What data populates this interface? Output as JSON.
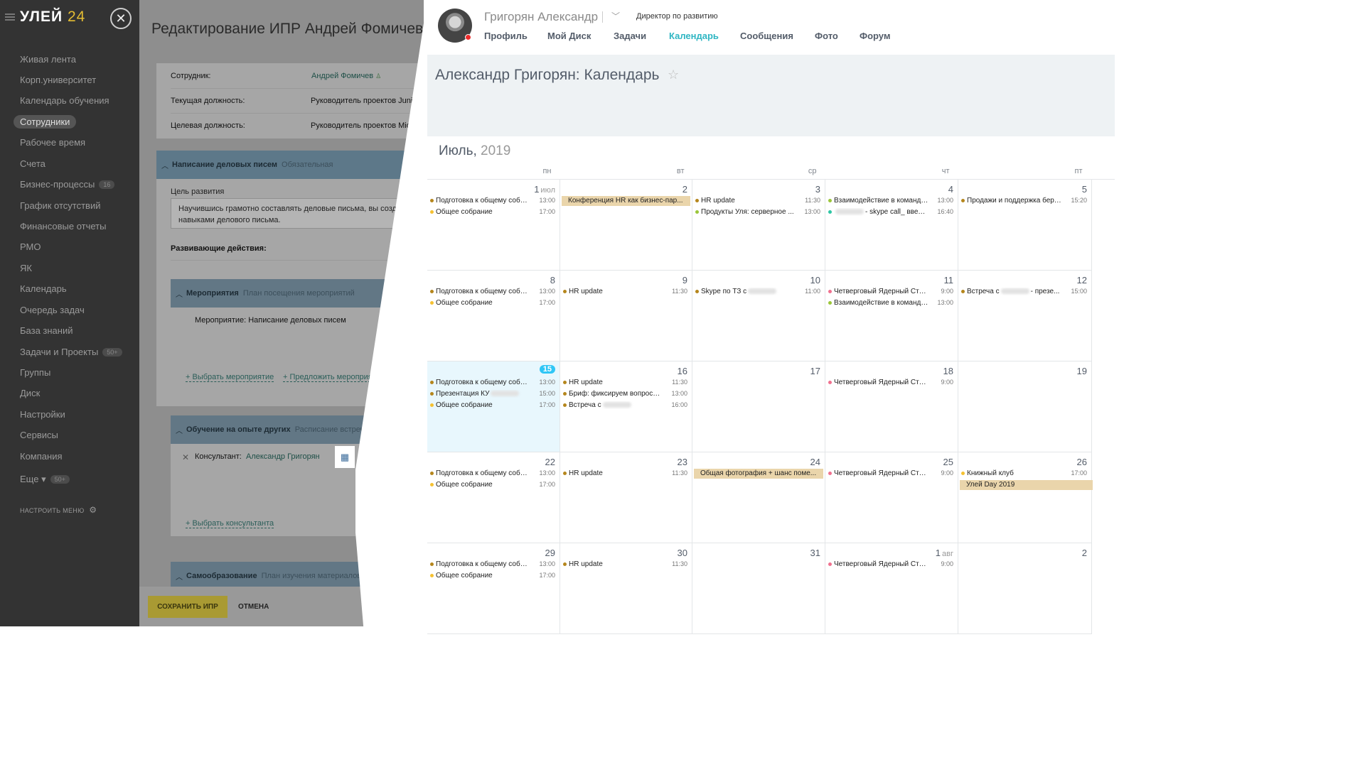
{
  "sidebar": {
    "logo_main": "УЛЕЙ",
    "logo_num": "24",
    "items": [
      {
        "label": "Живая лента",
        "badge": ""
      },
      {
        "label": "Корп.университет",
        "badge": ""
      },
      {
        "label": "Календарь обучения",
        "badge": ""
      },
      {
        "label": "Сотрудники",
        "badge": "",
        "active": true
      },
      {
        "label": "Рабочее время",
        "badge": ""
      },
      {
        "label": "Счета",
        "badge": ""
      },
      {
        "label": "Бизнес-процессы",
        "badge": "16"
      },
      {
        "label": "График отсутствий",
        "badge": ""
      },
      {
        "label": "Финансовые отчеты",
        "badge": ""
      },
      {
        "label": "РМО",
        "badge": ""
      },
      {
        "label": "ЯК",
        "badge": ""
      },
      {
        "label": "Календарь",
        "badge": ""
      },
      {
        "label": "Очередь задач",
        "badge": ""
      },
      {
        "label": "База знаний",
        "badge": ""
      },
      {
        "label": "Задачи и Проекты",
        "badge": "50+"
      },
      {
        "label": "Группы",
        "badge": ""
      },
      {
        "label": "Диск",
        "badge": ""
      },
      {
        "label": "Настройки",
        "badge": ""
      },
      {
        "label": "Сервисы",
        "badge": ""
      },
      {
        "label": "Компания",
        "badge": ""
      },
      {
        "label": "Еще ▾",
        "badge": "50+"
      }
    ],
    "config_label": "НАСТРОИТЬ МЕНЮ"
  },
  "ipr": {
    "title": "Редактирование ИПР Андрей Фомичев",
    "employee_label": "Сотрудник:",
    "employee_value": "Андрей Фомичев",
    "current_pos_label": "Текущая должность:",
    "current_pos_value": "Руководитель проектов Junior",
    "target_pos_label": "Целевая должность:",
    "target_pos_value": "Руководитель проектов Middle",
    "section1_title": "Написание деловых писем",
    "section1_sub": "Обязательная",
    "goal_label": "Цель развития",
    "goal_text_1": "Научившись грамотно составлять деловые письма, вы создадите",
    "goal_text_2": "навыками делового письма.",
    "actions_label": "Развивающие действия:",
    "events_title": "Мероприятия",
    "events_sub": "План посещения мероприятий",
    "event_item": "Мероприятие: Написание деловых писем",
    "choose_event": "+ Выбрать мероприятие",
    "suggest_event": "+ Предложить мероприятие",
    "learn_title": "Обучение на опыте других",
    "learn_sub": "Расписание встреч",
    "consultant_label": "Консультант:",
    "consultant_name": "Александр Григорян",
    "choose_consultant": "+ Выбрать консультанта",
    "self_title": "Самообразование",
    "self_sub": "План изучения материалов",
    "save_label": "СОХРАНИТЬ ИПР",
    "cancel_label": "ОТМЕНА"
  },
  "profile": {
    "name": "Григорян Александр",
    "position": "Директор по развитию",
    "tabs": [
      "Профиль",
      "Мой Диск",
      "Задачи",
      "Календарь",
      "Сообщения",
      "Фото",
      "Форум"
    ],
    "active_tab": "Календарь"
  },
  "calendar": {
    "title": "Александр Григорян: Календарь",
    "month": "Июль,",
    "year": "2019",
    "weekdays": [
      "пн",
      "вт",
      "ср",
      "чт",
      "пт"
    ],
    "colors": {
      "brown": "#b5861c",
      "yellow": "#f5c132",
      "green": "#9bc63a",
      "teal": "#2fc6a5",
      "pink": "#f0718f"
    },
    "weeks": [
      [
        {
          "day": "1",
          "month": "июл",
          "events": [
            {
              "text": "Подготовка к общему собра...",
              "time": "13:00",
              "color": "brown"
            },
            {
              "text": "Общее собрание",
              "time": "17:00",
              "color": "yellow"
            }
          ]
        },
        {
          "day": "2",
          "bars": [
            "Конференция HR как бизнес-пар..."
          ],
          "events": []
        },
        {
          "day": "3",
          "events": [
            {
              "text": "HR update",
              "time": "11:30",
              "color": "brown"
            },
            {
              "text": "Продукты Уля: серверное ...",
              "time": "13:00",
              "color": "green"
            }
          ]
        },
        {
          "day": "4",
          "events": [
            {
              "text": "Взаимодействие в команде:...",
              "time": "13:00",
              "color": "green"
            },
            {
              "text": "- skype call_ введе...",
              "time": "16:40",
              "color": "teal",
              "blur_before": true
            }
          ]
        },
        {
          "day": "5",
          "events": [
            {
              "text": "Продажи и поддержка беру...",
              "time": "15:20",
              "color": "brown"
            }
          ]
        }
      ],
      [
        {
          "day": "8",
          "events": [
            {
              "text": "Подготовка к общему собра...",
              "time": "13:00",
              "color": "brown"
            },
            {
              "text": "Общее собрание",
              "time": "17:00",
              "color": "yellow"
            }
          ]
        },
        {
          "day": "9",
          "events": [
            {
              "text": "HR update",
              "time": "11:30",
              "color": "brown"
            }
          ]
        },
        {
          "day": "10",
          "events": [
            {
              "text": "Skype по ТЗ с",
              "time": "11:00",
              "color": "brown",
              "blur_after": true
            }
          ]
        },
        {
          "day": "11",
          "events": [
            {
              "text": "Четверговый Ядерный Стояк",
              "time": "9:00",
              "color": "pink"
            },
            {
              "text": "Взаимодействие в команде:...",
              "time": "13:00",
              "color": "green"
            }
          ]
        },
        {
          "day": "12",
          "events": [
            {
              "text": "Встреча с",
              "suffix": "- презе...",
              "time": "15:00",
              "color": "brown",
              "blur_after": true
            }
          ]
        }
      ],
      [
        {
          "day": "15",
          "today": true,
          "events": [
            {
              "text": "Подготовка к общему собра...",
              "time": "13:00",
              "color": "brown"
            },
            {
              "text": "Презентация КУ",
              "time": "15:00",
              "color": "brown",
              "blur_after": true
            },
            {
              "text": "Общее собрание",
              "time": "17:00",
              "color": "yellow"
            }
          ]
        },
        {
          "day": "16",
          "events": [
            {
              "text": "HR update",
              "time": "11:30",
              "color": "brown"
            },
            {
              "text": "Бриф: фиксируем вопросы ...",
              "time": "13:00",
              "color": "brown"
            },
            {
              "text": "Встреча с",
              "time": "16:00",
              "color": "brown",
              "blur_after": true
            }
          ]
        },
        {
          "day": "17",
          "events": []
        },
        {
          "day": "18",
          "events": [
            {
              "text": "Четверговый Ядерный Стояк",
              "time": "9:00",
              "color": "pink"
            }
          ]
        },
        {
          "day": "19",
          "events": []
        }
      ],
      [
        {
          "day": "22",
          "events": [
            {
              "text": "Подготовка к общему собра...",
              "time": "13:00",
              "color": "brown"
            },
            {
              "text": "Общее собрание",
              "time": "17:00",
              "color": "yellow"
            }
          ]
        },
        {
          "day": "23",
          "events": [
            {
              "text": "HR update",
              "time": "11:30",
              "color": "brown"
            }
          ]
        },
        {
          "day": "24",
          "bars": [
            "Общая фотография + шанс поме..."
          ],
          "events": []
        },
        {
          "day": "25",
          "events": [
            {
              "text": "Четверговый Ядерный Стояк",
              "time": "9:00",
              "color": "pink"
            }
          ]
        },
        {
          "day": "26",
          "events": [
            {
              "text": "Книжный клуб",
              "time": "17:00",
              "color": "yellow"
            }
          ],
          "bars_after": [
            "Улей Day 2019"
          ]
        }
      ],
      [
        {
          "day": "29",
          "events": [
            {
              "text": "Подготовка к общему собра...",
              "time": "13:00",
              "color": "brown"
            },
            {
              "text": "Общее собрание",
              "time": "17:00",
              "color": "yellow"
            }
          ]
        },
        {
          "day": "30",
          "events": [
            {
              "text": "HR update",
              "time": "11:30",
              "color": "brown"
            }
          ]
        },
        {
          "day": "31",
          "events": []
        },
        {
          "day": "1",
          "month": "авг",
          "events": [
            {
              "text": "Четверговый Ядерный Стояк",
              "time": "9:00",
              "color": "pink"
            }
          ]
        },
        {
          "day": "2",
          "events": []
        }
      ]
    ]
  }
}
